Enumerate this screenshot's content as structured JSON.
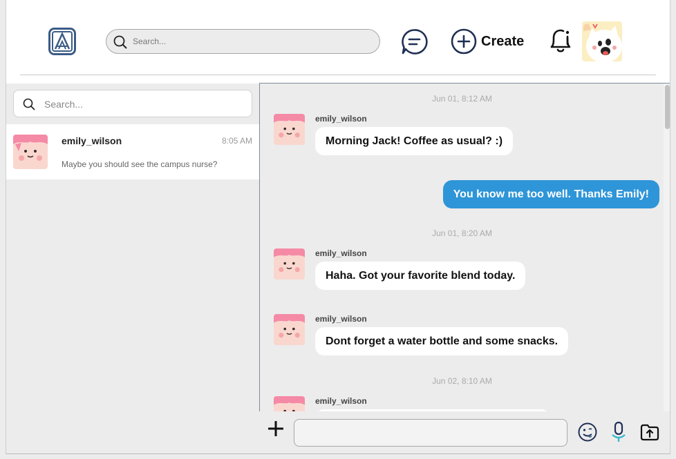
{
  "header": {
    "search_placeholder": "Search...",
    "create_label": "Create",
    "icons": [
      "app-logo-icon",
      "search-icon",
      "messages-icon",
      "create-plus-icon",
      "bell-icon",
      "profile-avatar"
    ]
  },
  "sidebar": {
    "search_placeholder": "Search...",
    "conversations": [
      {
        "name": "emily_wilson",
        "time": "8:05 AM",
        "preview": "Maybe you should see the campus nurse?"
      }
    ]
  },
  "chat": {
    "timestamps": [
      "Jun 01, 8:12 AM",
      "Jun 01, 8:20 AM",
      "Jun 02, 8:10 AM"
    ],
    "messages": [
      {
        "sender": "emily_wilson",
        "text": "Morning Jack! Coffee as usual? :)"
      },
      {
        "sender": "me",
        "text": "You know me too well. Thanks Emily!"
      },
      {
        "sender": "emily_wilson",
        "text": "Haha. Got your favorite blend today."
      },
      {
        "sender": "emily_wilson",
        "text": "Dont forget a water bottle and some snacks."
      },
      {
        "sender": "emily_wilson",
        "text": ""
      }
    ]
  },
  "composer": {
    "value": "",
    "icons": [
      "plus-icon",
      "emoji-icon",
      "microphone-icon",
      "upload-icon"
    ]
  },
  "colors": {
    "accent": "#2e95d8",
    "panel": "#ececec",
    "logo": "#3b5b86"
  }
}
